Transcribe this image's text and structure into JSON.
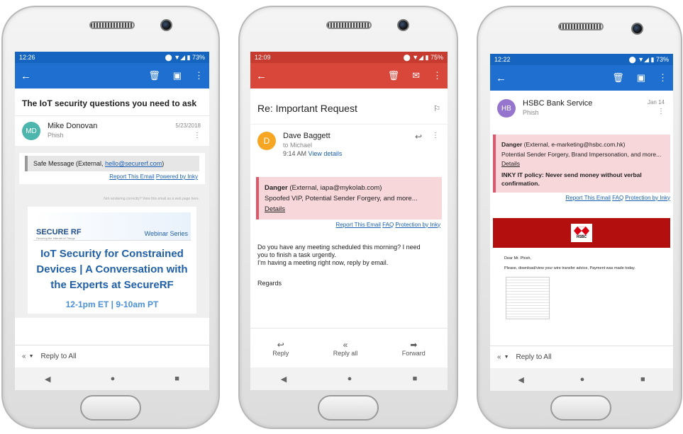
{
  "phone1": {
    "status": {
      "time": "12:26",
      "icons": "⬤ ▼◢ ▮ 73%"
    },
    "subject": "The IoT security questions you need to ask",
    "sender": {
      "initials": "MD",
      "name": "Mike Donovan",
      "sub": "Phish",
      "date": "5/23/2018"
    },
    "banner": {
      "prefix": "Safe Message (External, ",
      "email": "hello@securerf.com",
      "suffix": ")"
    },
    "links": {
      "report": "Report This Email",
      "powered": "Powered by Inky"
    },
    "not_rendering": "Not rendering correctly? View this email as a web page here.",
    "promo": {
      "logo": "SECURE RF",
      "logo_tag": "Securing the Internet of Things",
      "series": "Webinar Series",
      "headline": "IoT Security for Constrained Devices | A Conversation with the Experts at SecureRF",
      "time": "12-1pm ET | 9-10am PT"
    },
    "reply_all": "Reply to All",
    "colors": {
      "accent": "#1f6fd0",
      "safe_bg": "#e6e6e6",
      "promo_blue": "#1f5fa8"
    }
  },
  "phone2": {
    "status": {
      "time": "12:09",
      "icons": "⬤ ▼◢ ▮ 75%"
    },
    "subject": "Re: Important Request",
    "sender": {
      "initial": "D",
      "name": "Dave Baggett",
      "to": "to Michael",
      "time": "9:14 AM",
      "view_details": "View details"
    },
    "banner": {
      "danger": "Danger",
      "external": " (External, iapa@mykolab.com)",
      "line2": "Spoofed VIP, Potential Sender Forgery, and more...",
      "details": "Details"
    },
    "links": {
      "report": "Report This Email",
      "faq": "FAQ",
      "protection": "Protection by Inky"
    },
    "body": [
      "Do you have any meeting scheduled this morning? I need",
      "you to finish a task urgently.",
      "I'm having a meeting right now, reply by email."
    ],
    "regards": "Regards",
    "actions": {
      "reply": "Reply",
      "reply_all": "Reply all",
      "forward": "Forward"
    },
    "colors": {
      "accent": "#d9463a",
      "danger_bg": "#f7d7da",
      "danger_border": "#e0566a"
    }
  },
  "phone3": {
    "status": {
      "time": "12:22",
      "icons": "⬤ ▼◢ ▮ 73%"
    },
    "sender": {
      "initials": "HB",
      "name": "HSBC Bank Service",
      "sub": "Phish",
      "date": "Jan 14"
    },
    "banner": {
      "danger": "Danger",
      "external": " (External, e-marketing@hsbc.com.hk)",
      "line2": "Potential Sender Forgery, Brand Impersonation, and more...",
      "details": "Details",
      "policy": "INKY IT policy: Never send money without verbal confirmation."
    },
    "links": {
      "report": "Report This Email",
      "faq": "FAQ",
      "protection": "Protection by Inky"
    },
    "hsbc_logo": "HSBC",
    "greeting": "Dear Mr. Phish,",
    "body": "Please, download/view your wire transfer advice, Payment was made today.",
    "reply_all": "Reply to All",
    "colors": {
      "accent": "#1f6fd0",
      "hsbc_red": "#b30f0f",
      "danger_bg": "#f7d7da"
    }
  }
}
